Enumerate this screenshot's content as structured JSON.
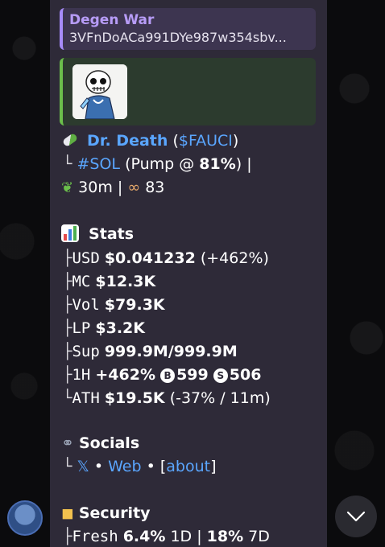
{
  "reply": {
    "title": "Degen War",
    "text": "3VFnDoACa991DYe987w354sbv..."
  },
  "token": {
    "name": "Dr. Death",
    "open_paren": " (",
    "ticker": "$FAUCI",
    "close_paren": ")",
    "chain_tag": "#SOL",
    "pump_text": " (Pump @ ",
    "pump_pct": "81%",
    "pump_close": ") |",
    "age": "30m",
    "age_sep": " | ",
    "watchers": "83"
  },
  "stats": {
    "heading": "Stats",
    "usd_label": "USD",
    "usd_value": "$0.041232",
    "usd_change": " (+462%)",
    "mc_label": "MC",
    "mc_value": "$12.3K",
    "vol_label": "Vol",
    "vol_value": "$79.3K",
    "lp_label": "LP",
    "lp_value": "$3.2K",
    "sup_label": "Sup",
    "sup_value": "999.9M/999.9M",
    "h1_label": "1H",
    "h1_value": "+462%",
    "buys": "599",
    "sells": "506",
    "ath_label": "ATH",
    "ath_value": "$19.5K",
    "ath_change": " (-37% / 11m)"
  },
  "socials": {
    "heading": "Socials",
    "x_icon": "𝕏",
    "sep1": " • ",
    "web": "Web",
    "sep2": " • [",
    "about": "about",
    "close": "]"
  },
  "security": {
    "heading": "Security",
    "fresh_label": "Fresh",
    "fresh_1d": "6.4%",
    "fresh_1d_label": " 1D | ",
    "fresh_7d": "18%",
    "fresh_7d_label": " 7D"
  },
  "colors": {
    "bubble": "#2e2a38",
    "link": "#5aa6ff",
    "reply_accent": "#a78bfa",
    "preview_accent": "#6bbf4b"
  }
}
